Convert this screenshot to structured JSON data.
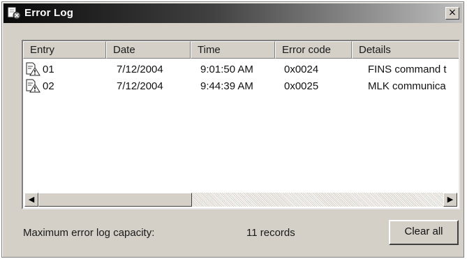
{
  "window": {
    "title": "Error Log",
    "close_label": "×",
    "title_icon": "error-log-icon"
  },
  "columns": [
    "Entry",
    "Date",
    "Time",
    "Error code",
    "Details"
  ],
  "rows": [
    {
      "entry": "01",
      "date": "7/12/2004",
      "time": "9:01:50 AM",
      "code": "0x0024",
      "details": "FINS command t",
      "icon": "warning-document-icon"
    },
    {
      "entry": "02",
      "date": "7/12/2004",
      "time": "9:44:39 AM",
      "code": "0x0025",
      "details": "MLK communica",
      "icon": "warning-document-icon"
    }
  ],
  "scrollbar": {
    "left_arrow": "◀",
    "right_arrow": "▶"
  },
  "footer": {
    "capacity_label": "Maximum error log capacity:",
    "capacity_value": "11 records",
    "clear_button": "Clear all"
  }
}
